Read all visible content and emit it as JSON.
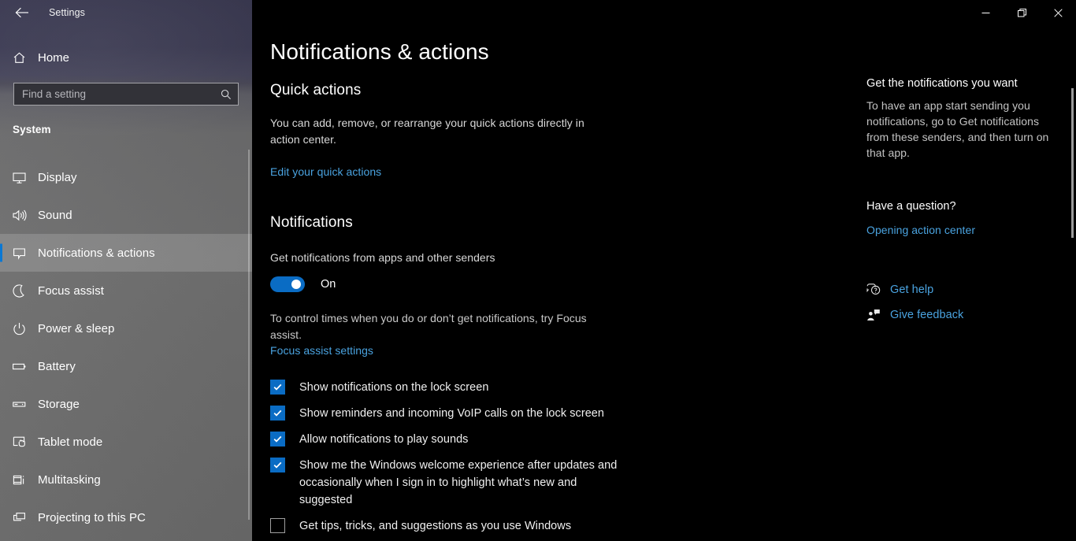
{
  "window": {
    "title": "Settings",
    "back_icon": "back-arrow-icon",
    "controls": [
      {
        "name": "minimize",
        "icon": "minimize-icon"
      },
      {
        "name": "restore",
        "icon": "restore-icon"
      },
      {
        "name": "close",
        "icon": "close-icon"
      }
    ]
  },
  "sidebar": {
    "home": {
      "label": "Home",
      "icon": "home-icon"
    },
    "search": {
      "placeholder": "Find a setting",
      "value": "",
      "icon": "search-icon"
    },
    "group_title": "System",
    "items": [
      {
        "label": "Display",
        "icon": "monitor-icon",
        "selected": false
      },
      {
        "label": "Sound",
        "icon": "speaker-icon",
        "selected": false
      },
      {
        "label": "Notifications & actions",
        "icon": "speech-bubble-icon",
        "selected": true
      },
      {
        "label": "Focus assist",
        "icon": "moon-icon",
        "selected": false
      },
      {
        "label": "Power & sleep",
        "icon": "power-icon",
        "selected": false
      },
      {
        "label": "Battery",
        "icon": "battery-icon",
        "selected": false
      },
      {
        "label": "Storage",
        "icon": "drive-icon",
        "selected": false
      },
      {
        "label": "Tablet mode",
        "icon": "tablet-hand-icon",
        "selected": false
      },
      {
        "label": "Multitasking",
        "icon": "multitasking-icon",
        "selected": false
      },
      {
        "label": "Projecting to this PC",
        "icon": "projecting-icon",
        "selected": false
      }
    ]
  },
  "main": {
    "page_title": "Notifications & actions",
    "quick_actions": {
      "heading": "Quick actions",
      "description": "You can add, remove, or rearrange your quick actions directly in action center.",
      "link": "Edit your quick actions"
    },
    "notifications": {
      "heading": "Notifications",
      "toggle_label": "Get notifications from apps and other senders",
      "toggle_state": "On",
      "toggle_on": true,
      "focus_note": "To control times when you do or don’t get notifications, try Focus assist.",
      "focus_link": "Focus assist settings",
      "checkboxes": [
        {
          "label": "Show notifications on the lock screen",
          "checked": true
        },
        {
          "label": "Show reminders and incoming VoIP calls on the lock screen",
          "checked": true
        },
        {
          "label": "Allow notifications to play sounds",
          "checked": true
        },
        {
          "label": "Show me the Windows welcome experience after updates and occasionally when I sign in to highlight what’s new and suggested",
          "checked": true
        },
        {
          "label": "Get tips, tricks, and suggestions as you use Windows",
          "checked": false
        }
      ]
    }
  },
  "right_rail": {
    "heading1": "Get the notifications you want",
    "body1": "To have an app start sending you notifications, go to Get notifications from these senders, and then turn on that app.",
    "heading2": "Have a question?",
    "link1": "Opening action center",
    "actions": [
      {
        "label": "Get help",
        "icon": "help-bubble-icon"
      },
      {
        "label": "Give feedback",
        "icon": "feedback-person-icon"
      }
    ]
  },
  "colors": {
    "accent": "#0a6cc4",
    "accent_bar": "#0a78d4",
    "link": "#4aa3e0",
    "background": "#000000",
    "sidebar_top": "#393850",
    "sidebar_bottom": "#6a6a6a"
  }
}
